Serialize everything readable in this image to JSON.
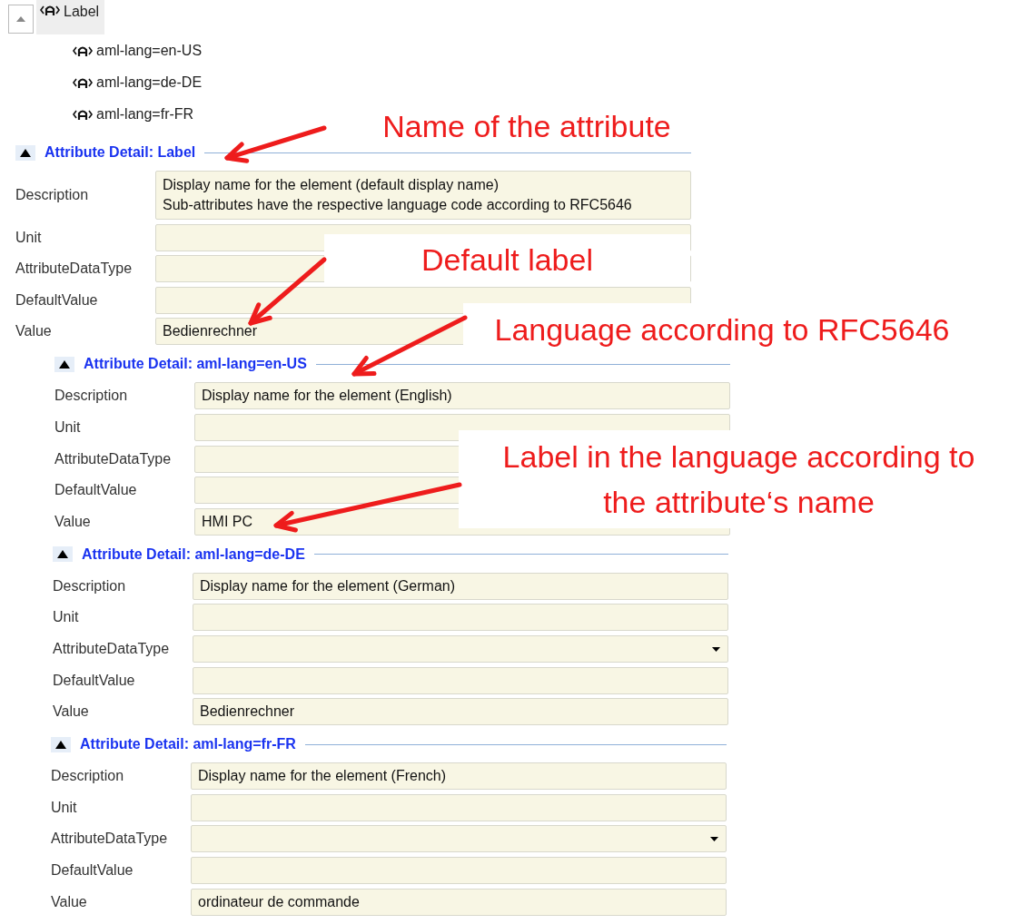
{
  "tree": {
    "expanded": true,
    "root": {
      "label": "Label",
      "selected": true,
      "children": [
        {
          "label": "aml-lang=en-US",
          "selected": false
        },
        {
          "label": "aml-lang=de-DE",
          "selected": false
        },
        {
          "label": "aml-lang=fr-FR",
          "selected": false
        }
      ]
    }
  },
  "sections": [
    {
      "title": "Attribute Detail: Label",
      "expanded": true,
      "fields": [
        {
          "label": "Description",
          "value": "Display name for the element (default display name)\nSub-attributes have the respective language code according to RFC5646"
        },
        {
          "label": "Unit"
        },
        {
          "label": "AttributeDataType"
        },
        {
          "label": "DefaultValue"
        },
        {
          "label": "Value",
          "value": "Bedienrechner"
        }
      ]
    },
    {
      "title": "Attribute Detail: aml-lang=en-US",
      "expanded": true,
      "fields": [
        {
          "label": "Description",
          "value": "Display name for the element (English)"
        },
        {
          "label": "Unit"
        },
        {
          "label": "AttributeDataType"
        },
        {
          "label": "DefaultValue"
        },
        {
          "label": "Value",
          "value": "HMI PC"
        }
      ]
    },
    {
      "title": "Attribute Detail: aml-lang=de-DE",
      "expanded": true,
      "fields": [
        {
          "label": "Description",
          "value": "Display name for the element (German)"
        },
        {
          "label": "Unit"
        },
        {
          "label": "AttributeDataType",
          "kind": "dropdown"
        },
        {
          "label": "DefaultValue"
        },
        {
          "label": "Value",
          "value": "Bedienrechner"
        }
      ]
    },
    {
      "title": "Attribute Detail: aml-lang=fr-FR",
      "expanded": true,
      "fields": [
        {
          "label": "Description",
          "value": "Display name for the element (French)"
        },
        {
          "label": "Unit"
        },
        {
          "label": "AttributeDataType",
          "kind": "dropdown"
        },
        {
          "label": "DefaultValue"
        },
        {
          "label": "Value",
          "value": "ordinateur de commande"
        }
      ]
    }
  ],
  "annotations": [
    {
      "text": "Name of the attribute"
    },
    {
      "text": "Default label"
    },
    {
      "text": "Language according to RFC5646"
    },
    {
      "text": "Label in the language according to\nthe attribute‘s name"
    }
  ]
}
